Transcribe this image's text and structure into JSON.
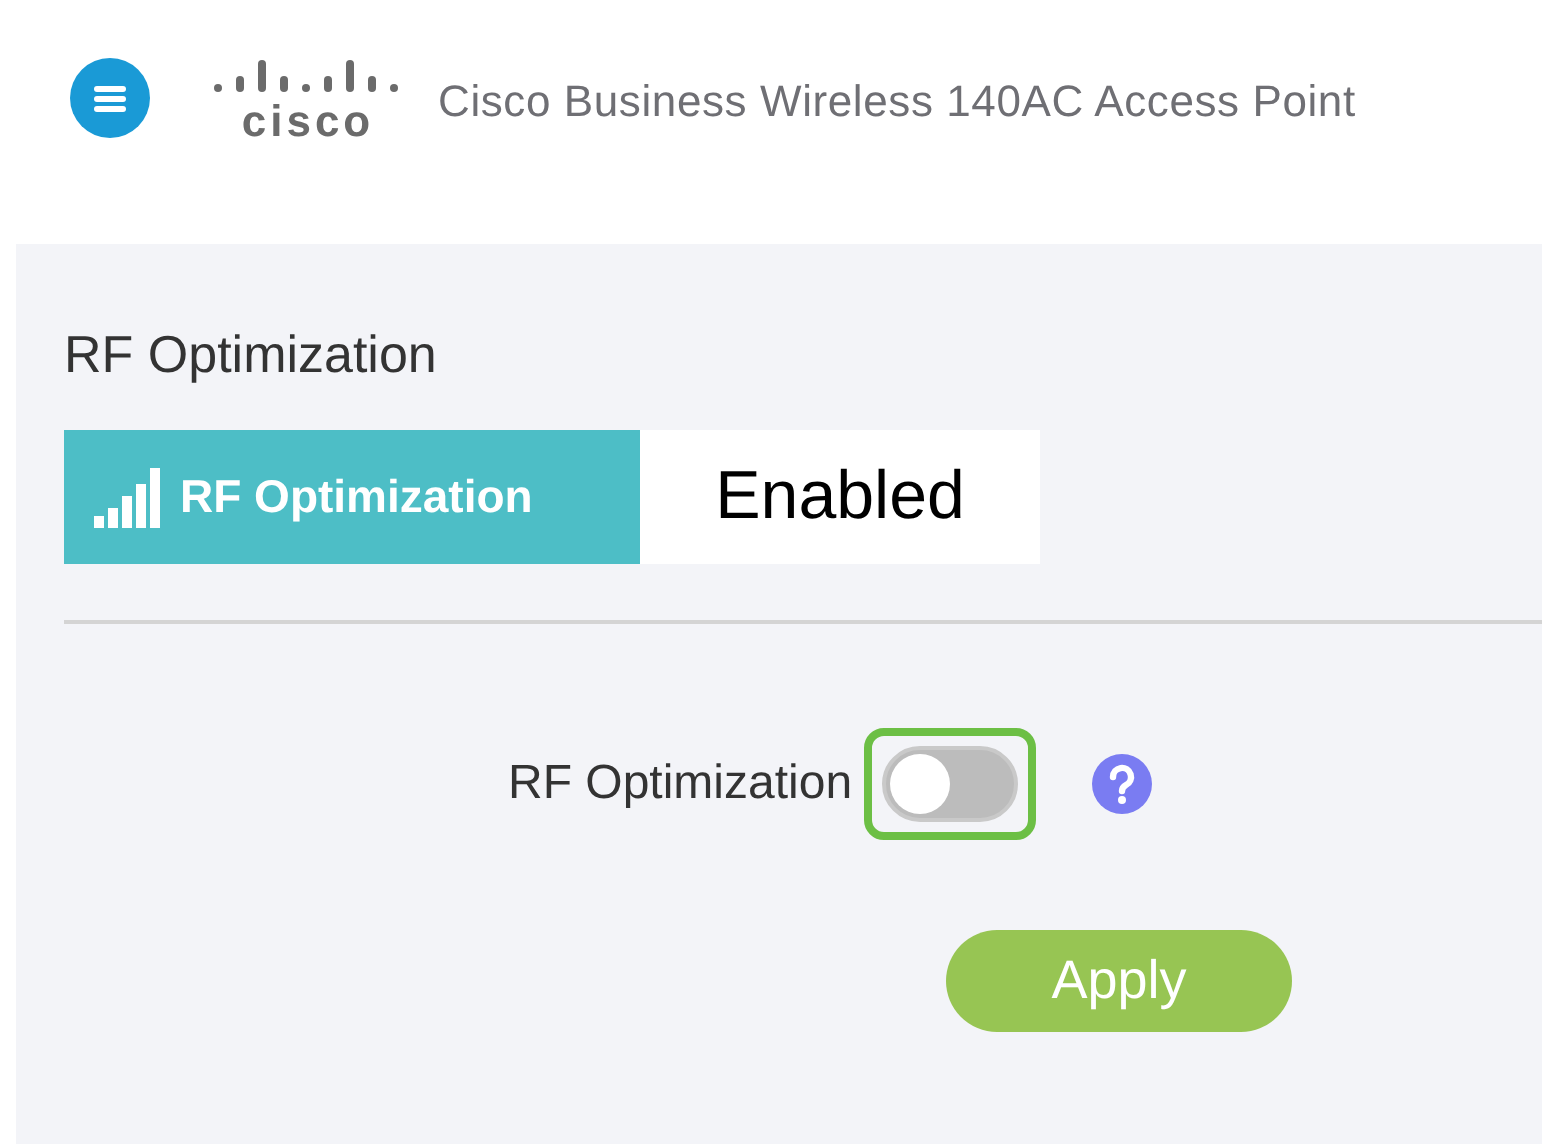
{
  "header": {
    "logo_text": "cisco",
    "product_title": "Cisco Business Wireless 140AC Access Point"
  },
  "panel": {
    "title": "RF Optimization",
    "status_badge": {
      "label": "RF Optimization",
      "value": "Enabled"
    },
    "setting": {
      "label": "RF Optimization",
      "on": false,
      "highlighted": true
    },
    "apply_button": "Apply"
  }
}
